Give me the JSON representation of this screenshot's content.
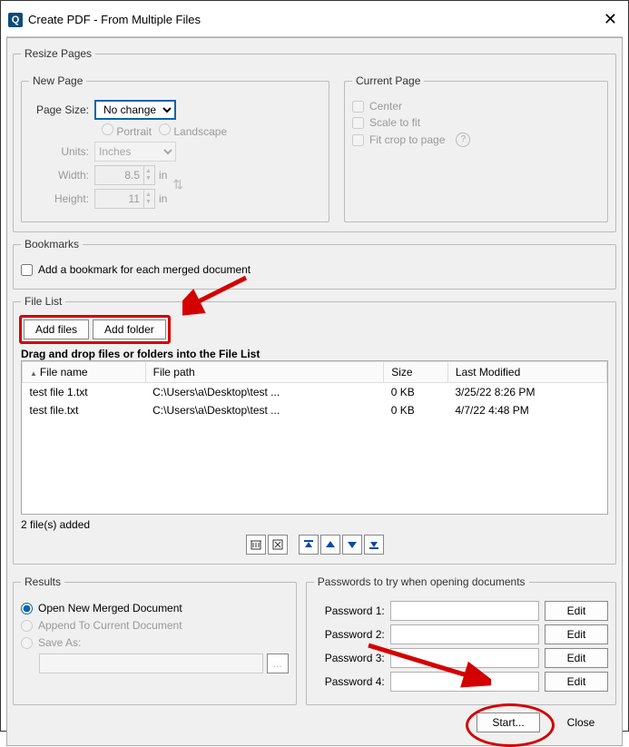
{
  "titlebar": {
    "title": "Create PDF - From Multiple Files"
  },
  "resize": {
    "legend": "Resize Pages",
    "newpage": {
      "legend": "New Page",
      "pagesize_label": "Page Size:",
      "pagesize_value": "No change",
      "orient_portrait": "Portrait",
      "orient_landscape": "Landscape",
      "units_label": "Units:",
      "units_value": "Inches",
      "width_label": "Width:",
      "width_value": "8.5",
      "height_label": "Height:",
      "height_value": "11",
      "unit_suffix": "in"
    },
    "current": {
      "legend": "Current Page",
      "center": "Center",
      "scale": "Scale to fit",
      "fitcrop": "Fit crop to page"
    }
  },
  "bookmarks": {
    "legend": "Bookmarks",
    "label": "Add a bookmark for each merged document"
  },
  "filelist": {
    "legend": "File List",
    "add_files": "Add files",
    "add_folder": "Add folder",
    "hint": "Drag and drop files or folders into the File List",
    "cols": {
      "name": "File name",
      "path": "File path",
      "size": "Size",
      "modified": "Last Modified"
    },
    "rows": [
      {
        "name": "test file 1.txt",
        "path": "C:\\Users\\a\\Desktop\\test ...",
        "size": "0 KB",
        "modified": "3/25/22 8:26 PM"
      },
      {
        "name": "test file.txt",
        "path": "C:\\Users\\a\\Desktop\\test ...",
        "size": "0 KB",
        "modified": "4/7/22 4:48 PM"
      }
    ],
    "status": "2 file(s) added"
  },
  "results": {
    "legend": "Results",
    "open_new": "Open New Merged Document",
    "append": "Append To Current Document",
    "saveas": "Save As:"
  },
  "passwords": {
    "legend": "Passwords to try when opening documents",
    "labels": [
      "Password 1:",
      "Password 2:",
      "Password 3:",
      "Password 4:"
    ],
    "edit": "Edit"
  },
  "footer": {
    "start": "Start...",
    "close": "Close"
  }
}
